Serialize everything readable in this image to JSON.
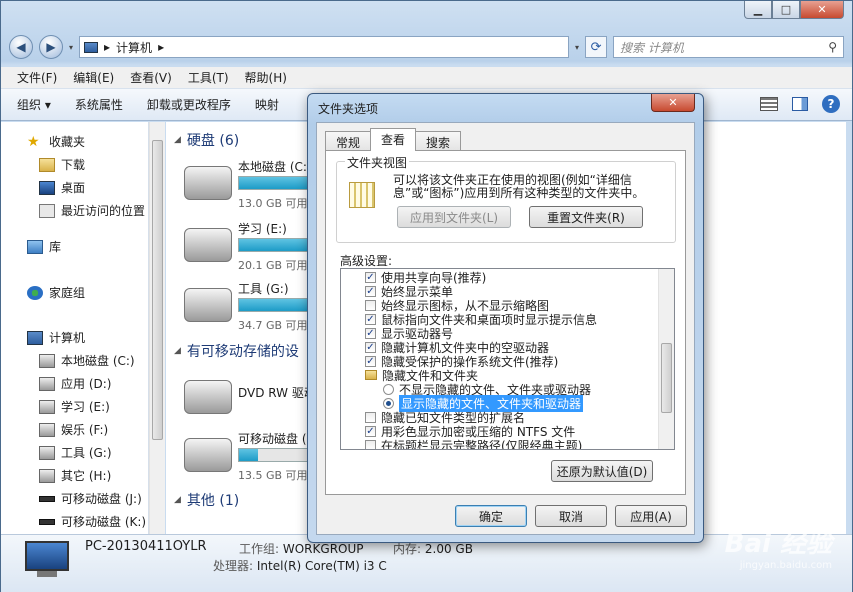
{
  "explorer": {
    "address": "计算机",
    "search_placeholder": "搜索 计算机",
    "menu": [
      "文件(F)",
      "编辑(E)",
      "查看(V)",
      "工具(T)",
      "帮助(H)"
    ],
    "toolbar": [
      "组织 ▾",
      "系统属性",
      "卸载或更改程序",
      "映射"
    ],
    "nav": {
      "favorites": "收藏夹",
      "downloads": "下载",
      "desktop": "桌面",
      "recent": "最近访问的位置",
      "libraries": "库",
      "homegroup": "家庭组",
      "computer": "计算机",
      "drives": [
        "本地磁盘 (C:)",
        "应用 (D:)",
        "学习 (E:)",
        "娱乐 (F:)",
        "工具 (G:)",
        "其它 (H:)",
        "可移动磁盘 (J:)",
        "可移动磁盘 (K:)"
      ]
    },
    "content": {
      "hdd_group": "硬盘 (6)",
      "removable_group": "有可移动存储的设",
      "other_group": "其他 (1)",
      "drives": [
        {
          "name": "本地磁盘 (C:)",
          "free": "13.0 GB 可用",
          "used": 0.8
        },
        {
          "name": "学习 (E:)",
          "free": "20.1 GB 可用",
          "used": 0.7
        },
        {
          "name": "工具 (G:)",
          "free": "34.7 GB 可用",
          "used": 0.6
        }
      ],
      "dvd": "DVD RW 驱动",
      "removable": {
        "name": "可移动磁盘 (",
        "free": "13.5 GB 可用",
        "used": 0.08
      }
    },
    "details": {
      "pc_name": "PC-20130411OYLR",
      "workgroup_label": "工作组:",
      "workgroup": "WORKGROUP",
      "memory_label": "内存:",
      "memory": "2.00 GB",
      "cpu_label": "处理器:",
      "cpu": "Intel(R) Core(TM) i3 C"
    }
  },
  "dialog": {
    "title": "文件夹选项",
    "tabs": [
      "常规",
      "查看",
      "搜索"
    ],
    "folder_views_legend": "文件夹视图",
    "folder_views_text": "可以将该文件夹正在使用的视图(例如“详细信息”或“图标”)应用到所有这种类型的文件夹中。",
    "apply_button": "应用到文件夹(L)",
    "reset_button": "重置文件夹(R)",
    "advanced_label": "高级设置:",
    "advanced_items": [
      {
        "type": "checkbox",
        "checked": true,
        "label": "使用共享向导(推荐)"
      },
      {
        "type": "checkbox",
        "checked": true,
        "label": "始终显示菜单"
      },
      {
        "type": "checkbox",
        "checked": false,
        "label": "始终显示图标，从不显示缩略图"
      },
      {
        "type": "checkbox",
        "checked": true,
        "label": "鼠标指向文件夹和桌面项时显示提示信息"
      },
      {
        "type": "checkbox",
        "checked": true,
        "label": "显示驱动器号"
      },
      {
        "type": "checkbox",
        "checked": true,
        "label": "隐藏计算机文件夹中的空驱动器"
      },
      {
        "type": "checkbox",
        "checked": true,
        "label": "隐藏受保护的操作系统文件(推荐)"
      },
      {
        "type": "folder",
        "label": "隐藏文件和文件夹"
      },
      {
        "type": "radio",
        "checked": false,
        "label": "不显示隐藏的文件、文件夹或驱动器"
      },
      {
        "type": "radio",
        "checked": true,
        "label": "显示隐藏的文件、文件夹和驱动器",
        "selected": true
      },
      {
        "type": "checkbox",
        "checked": false,
        "label": "隐藏已知文件类型的扩展名"
      },
      {
        "type": "checkbox",
        "checked": true,
        "label": "用彩色显示加密或压缩的 NTFS 文件"
      },
      {
        "type": "checkbox",
        "checked": false,
        "label": "在标题栏显示完整路径(仅限经典主题)"
      }
    ],
    "restore_button": "还原为默认值(D)",
    "ok_button": "确定",
    "cancel_button": "取消",
    "apply_footer_button": "应用(A)"
  },
  "watermark": {
    "text": "Bai 经验",
    "url": "jingyan.baidu.com"
  }
}
